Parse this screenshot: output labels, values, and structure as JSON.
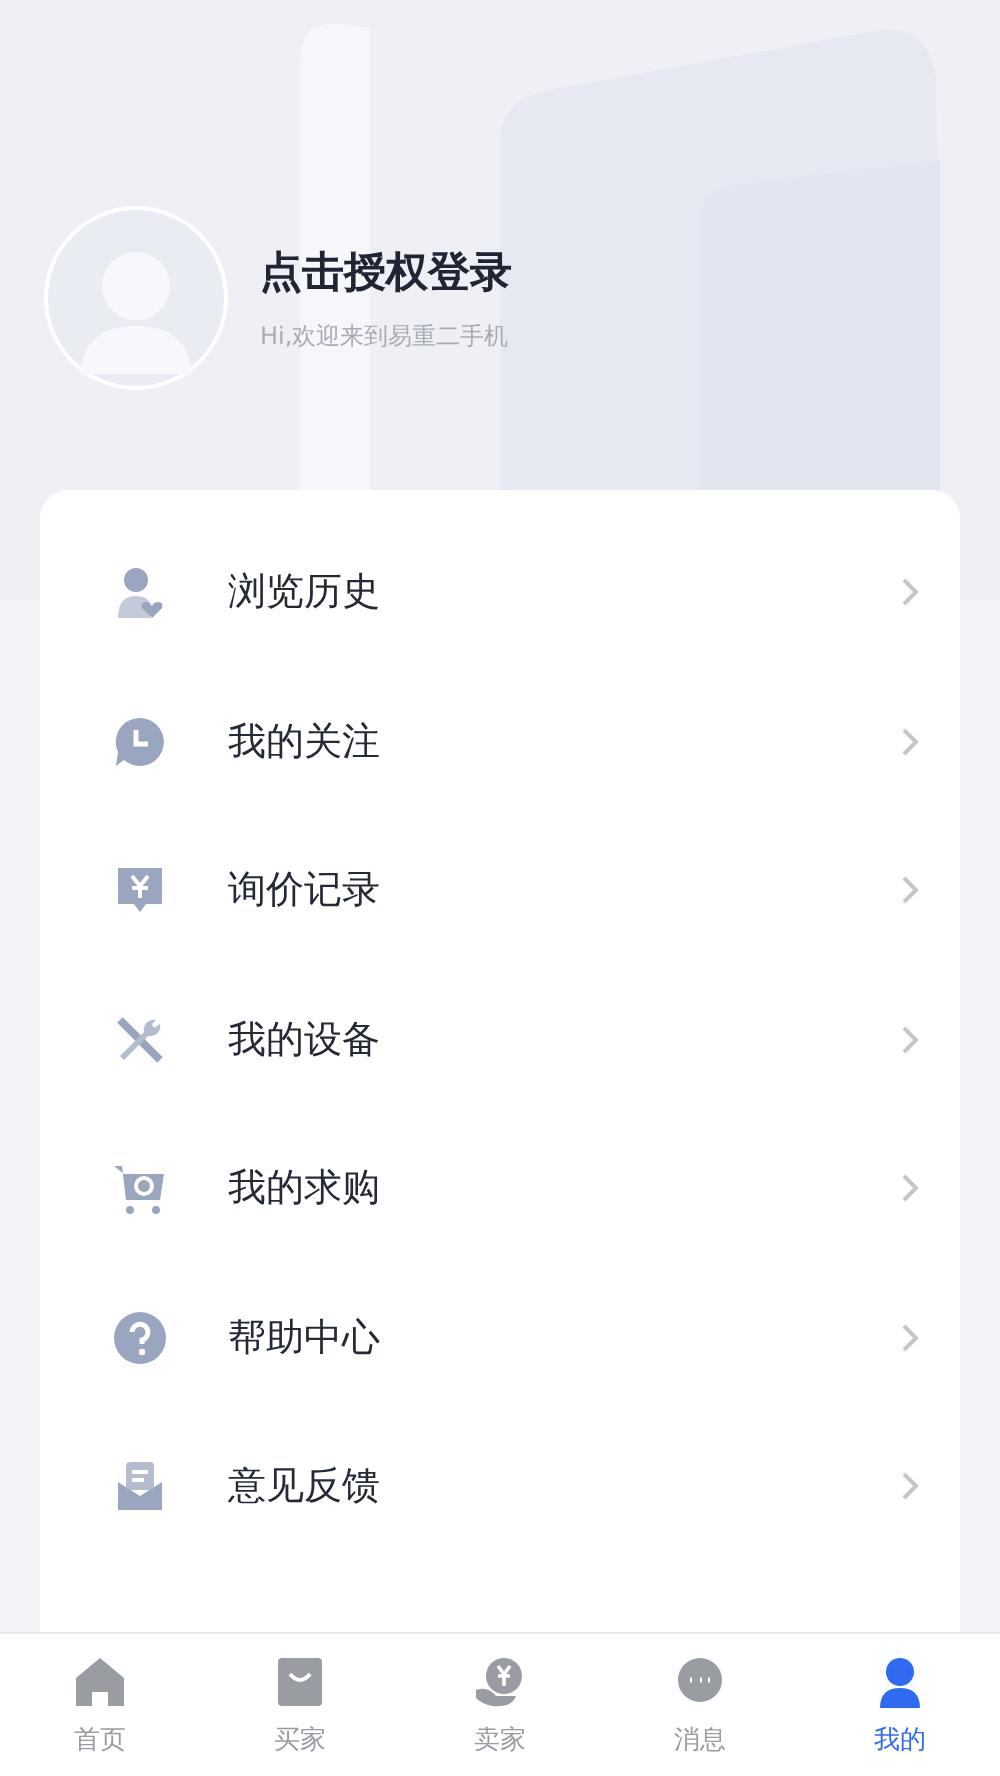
{
  "profile": {
    "title": "点击授权登录",
    "subtitle": "Hi,欢迎来到易重二手机"
  },
  "menu": [
    {
      "kind": "history",
      "label": "浏览历史"
    },
    {
      "kind": "follow",
      "label": "我的关注"
    },
    {
      "kind": "inquiry",
      "label": "询价记录"
    },
    {
      "kind": "device",
      "label": "我的设备"
    },
    {
      "kind": "purchase",
      "label": "我的求购"
    },
    {
      "kind": "help",
      "label": "帮助中心"
    },
    {
      "kind": "feedback",
      "label": "意见反馈"
    }
  ],
  "tab_bar": [
    {
      "kind": "home",
      "label": "首页",
      "selected": false
    },
    {
      "kind": "buyer",
      "label": "买家",
      "selected": false
    },
    {
      "kind": "seller",
      "label": "卖家",
      "selected": false
    },
    {
      "kind": "message",
      "label": "消息",
      "selected": false
    },
    {
      "kind": "mine",
      "label": "我的",
      "selected": true
    }
  ]
}
